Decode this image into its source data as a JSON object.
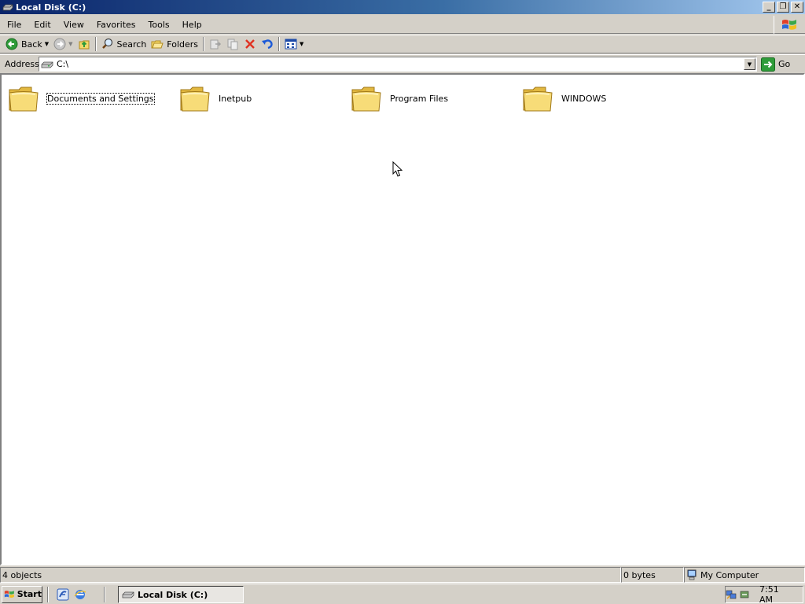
{
  "window": {
    "title": "Local Disk (C:)",
    "controls": {
      "minimize": "_",
      "restore": "❐",
      "close": "✕"
    }
  },
  "menu": [
    "File",
    "Edit",
    "View",
    "Favorites",
    "Tools",
    "Help"
  ],
  "toolbar": {
    "back_label": "Back",
    "search_label": "Search",
    "folders_label": "Folders"
  },
  "address": {
    "label": "Address",
    "value": "C:\\",
    "go_label": "Go"
  },
  "folders": [
    {
      "name": "Documents and Settings",
      "selected": true
    },
    {
      "name": "Inetpub",
      "selected": false
    },
    {
      "name": "Program Files",
      "selected": false
    },
    {
      "name": "WINDOWS",
      "selected": false
    }
  ],
  "status": {
    "objects": "4 objects",
    "size": "0 bytes",
    "location": "My Computer"
  },
  "taskbar": {
    "start_label": "Start",
    "task_label": "Local Disk (C:)",
    "clock": "7:51 AM"
  },
  "colors": {
    "folder_yellow": "#f5d86a",
    "titlebar_start": "#0a246a",
    "titlebar_end": "#a6caf0",
    "face": "#d4d0c8",
    "delete_red": "#e03020"
  }
}
